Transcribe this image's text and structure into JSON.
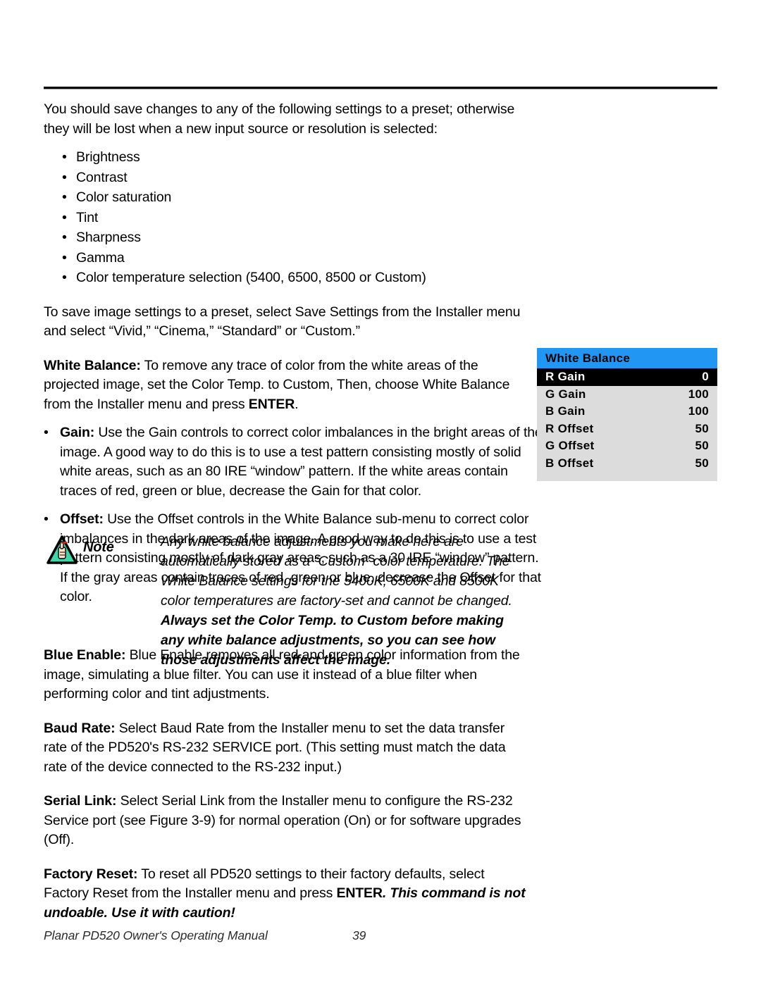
{
  "document": {
    "intro": "You should save changes to any of the following settings to a preset; otherwise they will be lost when a new input source or resolution is selected:",
    "bullet_marker": "•",
    "settings_list": [
      "Brightness",
      "Contrast",
      "Color saturation",
      "Tint",
      "Sharpness",
      "Gamma",
      "Color temperature selection (5400, 6500, 8500 or Custom)"
    ],
    "save_preset_paragraph": "To save image settings to a preset, select Save Settings from the Installer menu and select “Vivid,” “Cinema,” “Standard” or “Custom.”",
    "white_balance": {
      "term": "White Balance:",
      "body_before_enter": " To remove any trace of color from the white areas of the projected image, set the Color Temp. to Custom, Then, choose White Balance from the Installer menu and press ",
      "enter_word": "ENTER",
      "body_after_enter": "."
    },
    "gain_bullet": {
      "term": "Gain:",
      "body": " Use the Gain controls to correct color imbalances in the bright areas of the image. A good way to do this is to use a test pattern consisting mostly of solid white areas, such as an 80 IRE “window” pattern. If the white areas contain traces of red, green or blue, decrease the Gain for that color."
    },
    "offset_bullet": {
      "term": "Offset:",
      "body": " Use the Offset controls in the White Balance sub-menu to correct color imbalances in the dark areas of the image. A good way to do this is to use a test pattern consisting mostly of dark gray areas, such as a 30 IRE “window” pattern. If the gray areas contain traces of red, green or blue, decrease the Offset for that color."
    },
    "note": {
      "label": "Note",
      "icon": "note-hand-triangle-icon",
      "italic_text": "Any white balance adjustments you make here are automatically stored as a “Custom” color temperature. The White Balance settings for the 5400K, 6500K and 8500K color temperatures are factory-set and cannot be changed. ",
      "bold_text": "Always set the Color Temp. to Custom before making any white balance adjustments, so you can see how those adjustments affect the image."
    },
    "blue_enable": {
      "term": "Blue Enable:",
      "body": " Blue Enable removes all red and green color information from the image, simulating a blue filter. You can use it instead of a blue filter when performing color and tint adjustments."
    },
    "baud_rate": {
      "term": "Baud Rate:",
      "body": " Select Baud Rate from the Installer menu to set the data transfer rate of the PD520's RS-232 SERVICE port. (This setting must match the data rate of the device connected to the RS-232 input.)"
    },
    "serial_link": {
      "term": "Serial Link:",
      "body": " Select Serial Link from the Installer menu to configure the RS-232 Service port (see Figure 3-9) for normal operation (On) or for software upgrades (Off)."
    },
    "factory_reset": {
      "term": "Factory Reset:",
      "body_before_enter": " To reset all PD520 settings to their factory defaults, select Factory Reset from the Installer menu and press ",
      "enter_word": "ENTER",
      "warning": ". This command is not undoable. Use it with caution!"
    }
  },
  "osd_menu": {
    "title": "White Balance",
    "title_bg_color": "#2196f3",
    "body_bg_color": "#dcdcdc",
    "selected_bg_color": "#000000",
    "rows": [
      {
        "label": "R Gain",
        "value": "0",
        "selected": true
      },
      {
        "label": "G Gain",
        "value": "100",
        "selected": false
      },
      {
        "label": "B Gain",
        "value": "100",
        "selected": false
      },
      {
        "label": "R Offset",
        "value": "50",
        "selected": false
      },
      {
        "label": "G Offset",
        "value": "50",
        "selected": false
      },
      {
        "label": "B Offset",
        "value": "50",
        "selected": false
      }
    ]
  },
  "footer": {
    "manual_title": "Planar PD520 Owner's Operating Manual",
    "page_number": "39"
  }
}
